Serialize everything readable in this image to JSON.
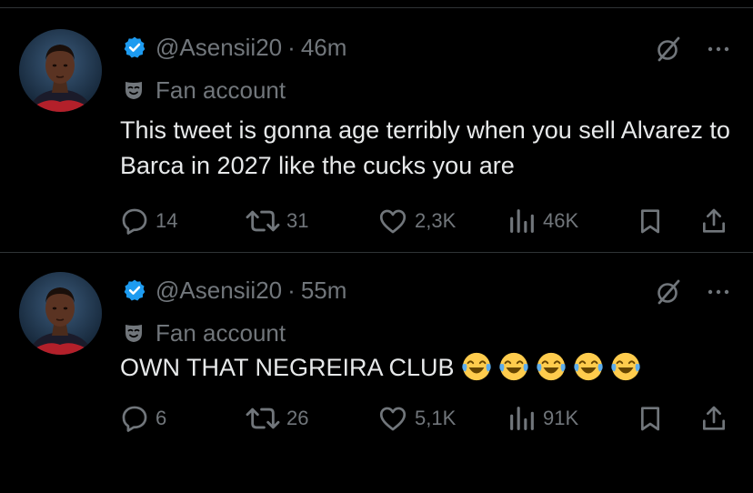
{
  "colors": {
    "background": "#000000",
    "text": "#e7e9ea",
    "muted": "#71767b",
    "divider": "#2f3336",
    "verified": "#1d9bf0"
  },
  "tweets": [
    {
      "handle": "@Asensii20",
      "separator": "·",
      "time": "46m",
      "label": "Fan account",
      "text": "This tweet is gonna age terribly when you sell Alvarez to Barca in 2027 like the cucks you are",
      "emojis": [],
      "replies": "14",
      "reposts": "31",
      "likes": "2,3K",
      "views": "46K",
      "icons": [
        "verified-badge-icon",
        "mask-icon",
        "grok-icon",
        "more-icon",
        "reply-icon",
        "repost-icon",
        "like-icon",
        "views-icon",
        "bookmark-icon",
        "share-icon"
      ]
    },
    {
      "handle": "@Asensii20",
      "separator": "·",
      "time": "55m",
      "label": "Fan account",
      "text": "OWN THAT NEGREIRA CLUB",
      "emojis": [
        "😂",
        "😂",
        "😂",
        "😂",
        "😂"
      ],
      "replies": "6",
      "reposts": "26",
      "likes": "5,1K",
      "views": "91K",
      "icons": [
        "verified-badge-icon",
        "mask-icon",
        "grok-icon",
        "more-icon",
        "reply-icon",
        "repost-icon",
        "like-icon",
        "views-icon",
        "bookmark-icon",
        "share-icon"
      ]
    }
  ]
}
